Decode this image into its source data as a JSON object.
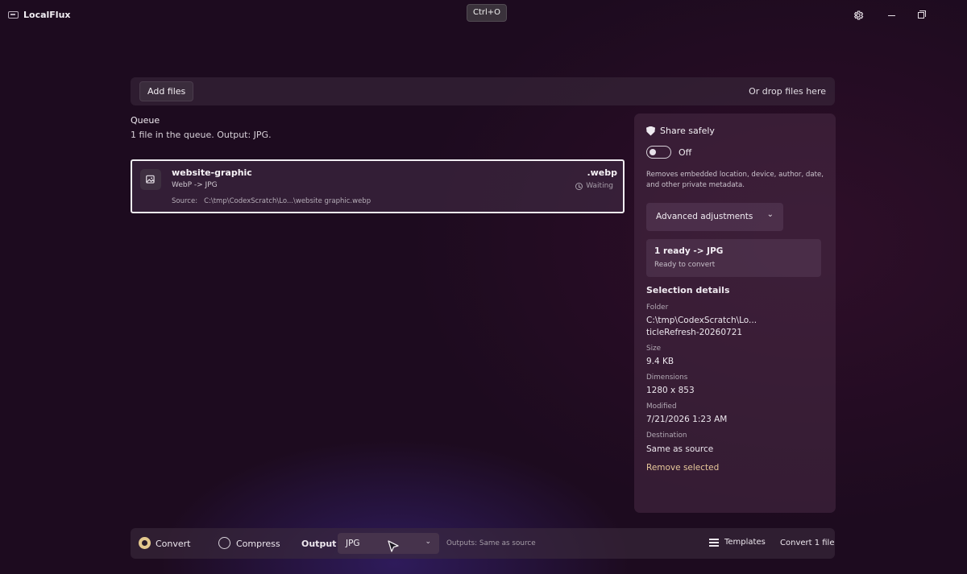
{
  "app": {
    "title": "LocalFlux",
    "shortcut": "Ctrl+O"
  },
  "icons": {
    "settings": "gear-icon",
    "minimize": "minimize-icon",
    "restore": "restore-icon",
    "file": "image-file-icon",
    "shield": "shield-icon",
    "clock": "clock-icon",
    "templates": "list-icon"
  },
  "dropzone": {
    "add_label": "Add files",
    "hint": "Or drop files here"
  },
  "queue": {
    "title": "Queue",
    "summary": "1 file in the queue. Output: JPG.",
    "items": [
      {
        "name": "website-graphic",
        "conversion": "WebP -> JPG",
        "source_label": "Source:",
        "source_path": "C:\\tmp\\CodexScratch\\Lo...\\website graphic.webp",
        "extension": ".webp",
        "status": "Waiting"
      }
    ]
  },
  "sidebar": {
    "share": {
      "label": "Share safely",
      "toggle_state": "Off",
      "description": "Removes embedded location, device, author, date, and other private metadata."
    },
    "advanced_label": "Advanced adjustments",
    "ready": {
      "title": "1 ready -> JPG",
      "subtitle": "Ready to convert"
    },
    "details": {
      "title": "Selection details",
      "folder_label": "Folder",
      "folder_line1": "C:\\tmp\\CodexScratch\\Lo...",
      "folder_line2": "ticleRefresh-20260721",
      "size_label": "Size",
      "size_value": "9.4 KB",
      "dimensions_label": "Dimensions",
      "dimensions_value": "1280 x 853",
      "modified_label": "Modified",
      "modified_value": "7/21/2026 1:23 AM",
      "destination_label": "Destination",
      "destination_value": "Same as source"
    },
    "remove_label": "Remove selected"
  },
  "bottom": {
    "mode_convert": "Convert",
    "mode_compress": "Compress",
    "selected_mode": "Convert",
    "output_label": "Output",
    "output_value": "JPG",
    "outputs_hint": "Outputs: Same as source",
    "templates_label": "Templates",
    "convert_button": "Convert 1 file"
  },
  "colors": {
    "background": "#1d0b1f",
    "accent": "#e4c88e",
    "link": "#e7c79a"
  }
}
